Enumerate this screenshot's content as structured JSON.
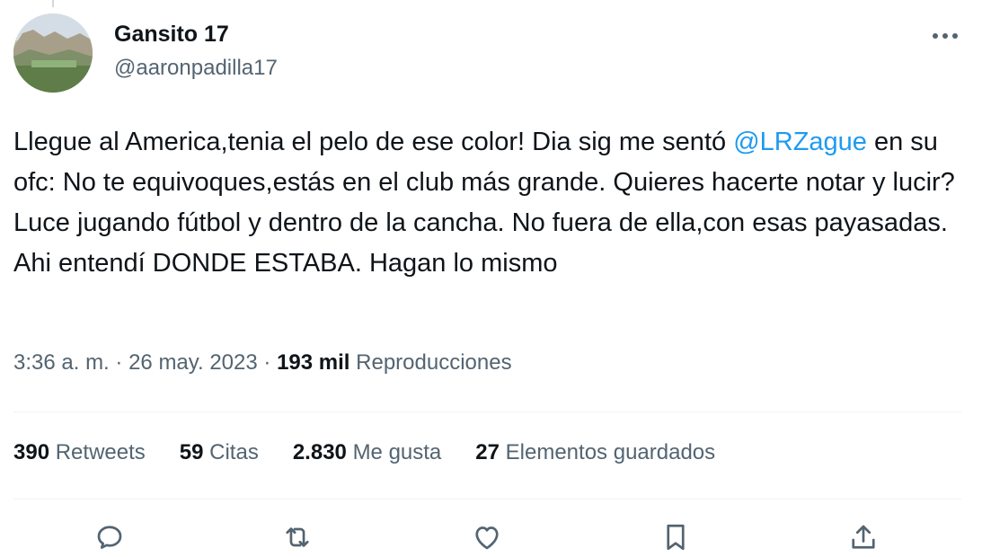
{
  "author": {
    "display_name": "Gansito 17",
    "handle": "@aaronpadilla17"
  },
  "tweet": {
    "text_before_mention": "Llegue al America,tenia el pelo de ese color! Dia sig me sentó ",
    "mention": "@LRZague",
    "text_after_mention": " en su ofc: No te equivoques,estás en el club más grande. Quieres hacerte notar y lucir? Luce jugando fútbol y dentro de la cancha. No fuera de ella,con esas payasadas. Ahi entendí DONDE ESTABA. Hagan lo mismo"
  },
  "meta": {
    "time": "3:36 a. m.",
    "separator": "·",
    "date": "26 may. 2023",
    "views_count": "193 mil",
    "views_label": "Reproducciones"
  },
  "stats": [
    {
      "count": "390",
      "label": "Retweets"
    },
    {
      "count": "59",
      "label": "Citas"
    },
    {
      "count": "2.830",
      "label": "Me gusta"
    },
    {
      "count": "27",
      "label": "Elementos guardados"
    }
  ],
  "actions": [
    {
      "icon": "reply-icon"
    },
    {
      "icon": "retweet-icon"
    },
    {
      "icon": "like-icon"
    },
    {
      "icon": "bookmark-icon"
    },
    {
      "icon": "share-icon"
    }
  ],
  "colors": {
    "text": "#0f1419",
    "secondary": "#536471",
    "accent": "#1d9bf0",
    "divider": "#eff3f4"
  }
}
